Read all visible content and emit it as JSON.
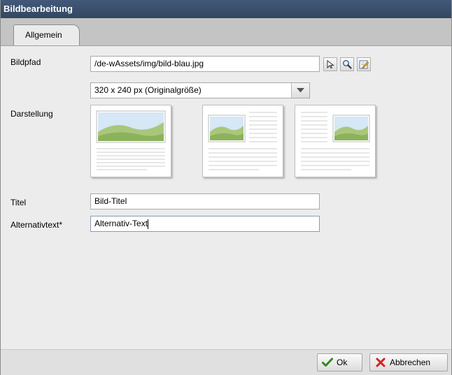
{
  "dialog": {
    "title": "Bildbearbeitung",
    "tabs": [
      {
        "label": "Allgemein",
        "active": true
      }
    ]
  },
  "form": {
    "image_path": {
      "label": "Bildpfad",
      "value": "/de-wAssets/img/bild-blau.jpg"
    },
    "size_select": {
      "value": "320 x 240 px (Originalgröße)"
    },
    "display": {
      "label": "Darstellung",
      "options": [
        {
          "name": "image-top"
        },
        {
          "name": "image-left"
        },
        {
          "name": "image-right"
        }
      ]
    },
    "title_field": {
      "label": "Titel",
      "value": "Bild-Titel"
    },
    "alt_field": {
      "label": "Alternativtext*",
      "value": "Alternativ-Text"
    }
  },
  "footer": {
    "ok_label": "Ok",
    "cancel_label": "Abbrechen"
  },
  "colors": {
    "titlebar": "#3a4f6b",
    "ok_icon": "#2f8a1d",
    "cancel_icon": "#d32020"
  }
}
